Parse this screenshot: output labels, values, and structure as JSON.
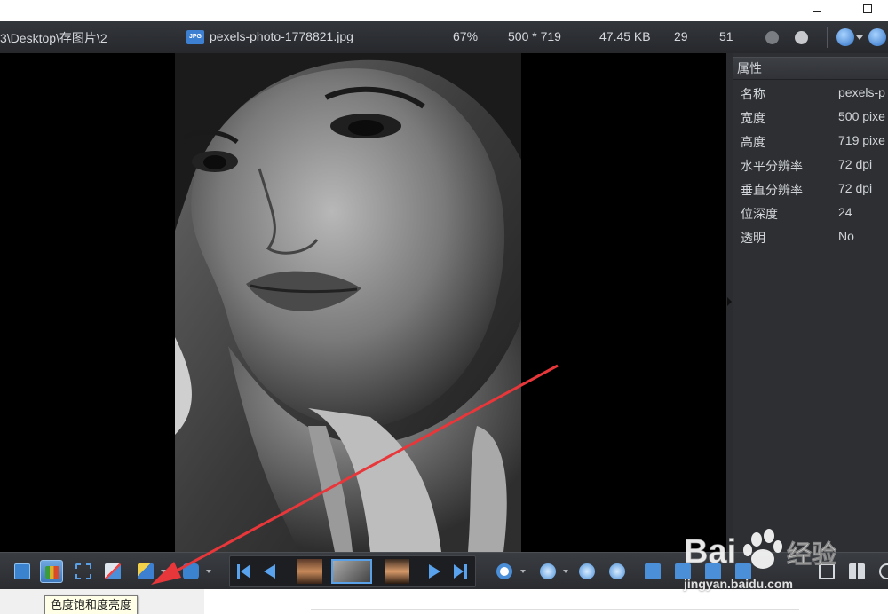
{
  "window": {
    "minimize_icon": "minimize-icon",
    "maximize_icon": "maximize-icon"
  },
  "infobar": {
    "path": "3\\Desktop\\存图片\\2",
    "file_icon": "JPG",
    "filename": "pexels-photo-1778821.jpg",
    "zoom": "67%",
    "dimensions": "500 * 719",
    "filesize": "47.45 KB",
    "index": "29",
    "total": "51"
  },
  "properties": {
    "title": "属性",
    "rows": [
      {
        "key": "名称",
        "value": "pexels-p"
      },
      {
        "key": "宽度",
        "value": "500 pixe"
      },
      {
        "key": "高度",
        "value": "719 pixe"
      },
      {
        "key": "水平分辨率",
        "value": "72 dpi"
      },
      {
        "key": "垂直分辨率",
        "value": "72 dpi"
      },
      {
        "key": "位深度",
        "value": "24"
      },
      {
        "key": "透明",
        "value": "No"
      }
    ]
  },
  "toolbar": {
    "tooltip": "色度饱和度亮度",
    "colors": {
      "accent": "#3e79bd",
      "filmstrip_selected": "#5aa0e6",
      "annotation_arrow": "#e8373a"
    }
  },
  "watermark": {
    "text": "Bai",
    "suffix": "经验",
    "url": "jingyan.baidu.com"
  }
}
